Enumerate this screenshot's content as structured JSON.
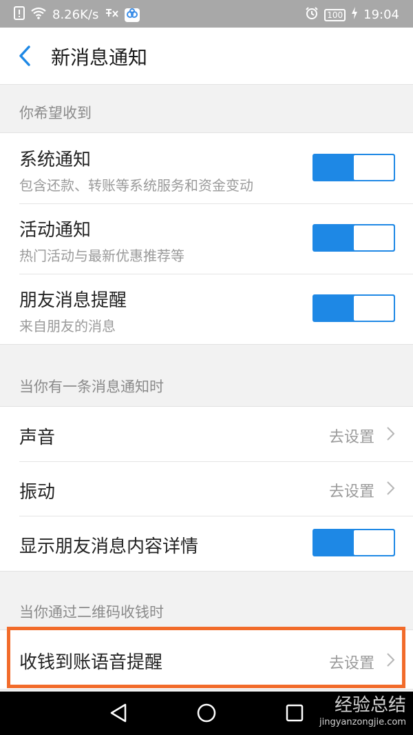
{
  "status_bar": {
    "net_speed": "8.26K/s",
    "battery": "100",
    "time": "19:04"
  },
  "header": {
    "title": "新消息通知"
  },
  "section1": {
    "label": "你希望收到",
    "items": [
      {
        "title": "系统通知",
        "subtitle": "包含还款、转账等系统服务和资金变动",
        "enabled": true
      },
      {
        "title": "活动通知",
        "subtitle": "热门活动与最新优惠推荐等",
        "enabled": true
      },
      {
        "title": "朋友消息提醒",
        "subtitle": "来自朋友的消息",
        "enabled": true
      }
    ]
  },
  "section2": {
    "label": "当你有一条消息通知时",
    "items": [
      {
        "title": "声音",
        "action": "去设置"
      },
      {
        "title": "振动",
        "action": "去设置"
      },
      {
        "title": "显示朋友消息内容详情",
        "enabled": true
      }
    ]
  },
  "section3": {
    "label": "当你通过二维码收钱时",
    "items": [
      {
        "title": "收钱到账语音提醒",
        "action": "去设置"
      }
    ]
  },
  "colors": {
    "toggle_on": "#1e88e5",
    "back_arrow": "#1e88e5",
    "highlight": "#f26b2a"
  },
  "watermark": {
    "brand": "经验总结",
    "url": "jingyanzongjie.com"
  }
}
